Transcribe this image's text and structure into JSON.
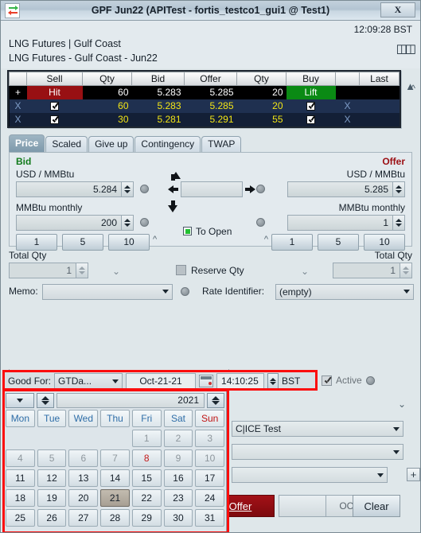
{
  "window": {
    "title": "GPF Jun22 (APITest - fortis_testco1_gui1 @ Test1)",
    "close_label": "X",
    "app_icon": "transfer-arrows-icon"
  },
  "header": {
    "clock": "12:09:28 BST",
    "instrument_line1": "LNG Futures | Gulf Coast",
    "instrument_line2": "LNG Futures - Gulf Coast - Jun22",
    "expand_icon": "double-chevron-right-icon"
  },
  "depth": {
    "columns": [
      "",
      "Sell",
      "Qty",
      "Bid",
      "Offer",
      "Qty",
      "Buy",
      "",
      "Last"
    ],
    "collapse_icon": "double-chevron-up-icon",
    "rows": [
      {
        "marker": "+",
        "sell": "Hit",
        "sell_type": "hit-button",
        "qty_bid": "60",
        "bid": "5.283",
        "offer": "5.285",
        "qty_offer": "20",
        "buy": "Lift",
        "buy_type": "lift-button",
        "cancel": "",
        "last": ""
      },
      {
        "marker": "X",
        "sell": "checked",
        "sell_type": "checkbox",
        "qty_bid": "60",
        "bid": "5.283",
        "offer": "5.285",
        "qty_offer": "20",
        "buy": "checked",
        "buy_type": "checkbox",
        "cancel": "X",
        "last": ""
      },
      {
        "marker": "X",
        "sell": "checked",
        "sell_type": "checkbox",
        "qty_bid": "30",
        "bid": "5.281",
        "offer": "5.291",
        "qty_offer": "55",
        "buy": "checked",
        "buy_type": "checkbox",
        "cancel": "X",
        "last": ""
      }
    ]
  },
  "tabs": [
    {
      "label": "Price",
      "active": true
    },
    {
      "label": "Scaled",
      "active": false
    },
    {
      "label": "Give up",
      "active": false
    },
    {
      "label": "Contingency",
      "active": false
    },
    {
      "label": "TWAP",
      "active": false
    }
  ],
  "price_panel": {
    "bid_label": "Bid",
    "offer_label": "Offer",
    "bid_unit": "USD / MMBtu",
    "offer_unit": "USD / MMBtu",
    "bid_price": "5.284",
    "offer_price": "5.285",
    "bid_qty_label": "MMBtu monthly",
    "offer_qty_label": "MMBtu monthly",
    "bid_qty": "200",
    "offer_qty": "1",
    "bid_quick_buttons": [
      "1",
      "5",
      "10"
    ],
    "offer_quick_buttons": [
      "1",
      "5",
      "10"
    ],
    "middle_value": "",
    "to_open_label": "To Open",
    "icons": {
      "up": "arrow-up-icon",
      "down": "arrow-down-icon",
      "left": "arrow-left-icon",
      "right": "arrow-right-icon",
      "collapse": "double-chevron-up-icon",
      "led": "status-led-icon"
    }
  },
  "totals": {
    "bid_total_label": "Total Qty",
    "offer_total_label": "Total Qty",
    "bid_total": "1",
    "offer_total": "1",
    "reserve_qty_label": "Reserve Qty",
    "reserve_checked": false,
    "expand_icon": "double-chevron-down-icon"
  },
  "memo_row": {
    "memo_label": "Memo:",
    "memo_value": "",
    "rate_identifier_label": "Rate Identifier:",
    "rate_identifier_value": "(empty)"
  },
  "good_for": {
    "label": "Good For:",
    "type_value": "GTDa...",
    "date_value": "Oct-21-21",
    "calendar_icon": "calendar-icon",
    "time_value": "14:10:25",
    "timezone": "BST",
    "active_label": "Active",
    "active_checked": true
  },
  "calendar": {
    "month_dropdown": "",
    "year": "2021",
    "day_headers": [
      "Mon",
      "Tue",
      "Wed",
      "Thu",
      "Fri",
      "Sat",
      "Sun"
    ],
    "weeks": [
      [
        "",
        "",
        "",
        "",
        "1",
        "2",
        "3"
      ],
      [
        "4",
        "5",
        "6",
        "7",
        "8",
        "9",
        "10"
      ],
      [
        "11",
        "12",
        "13",
        "14",
        "15",
        "16",
        "17"
      ],
      [
        "18",
        "19",
        "20",
        "21",
        "22",
        "23",
        "24"
      ],
      [
        "25",
        "26",
        "27",
        "28",
        "29",
        "30",
        "31"
      ]
    ],
    "selected_day": "21",
    "highlighted_red_day": "8",
    "muted_days": [
      "1",
      "2",
      "3",
      "4",
      "5",
      "6",
      "7",
      "9",
      "10"
    ]
  },
  "bottom_form": {
    "account_value": "C|ICE Test",
    "second_value": "",
    "third_value": "",
    "add_icon": "plus-icon",
    "offer_button": "Offer",
    "oco_button": "OCO",
    "clear_button": "Clear"
  }
}
